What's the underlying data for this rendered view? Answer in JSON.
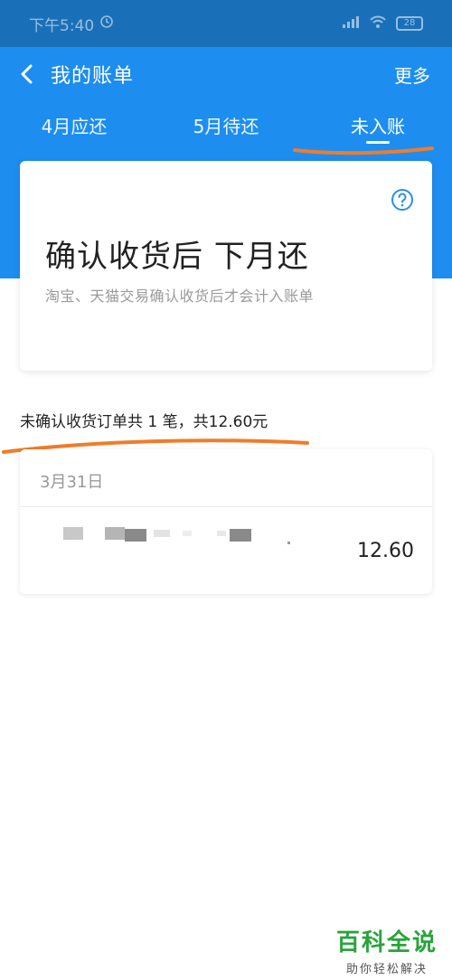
{
  "status_bar": {
    "time": "下午5:40",
    "battery": "28"
  },
  "nav": {
    "title": "我的账单",
    "more": "更多"
  },
  "tabs": [
    {
      "label": "4月应还"
    },
    {
      "label": "5月待还"
    },
    {
      "label": "未入账"
    }
  ],
  "info_card": {
    "title": "确认收货后 下月还",
    "subtitle": "淘宝、天猫交易确认收货后才会计入账单"
  },
  "summary": "未确认收货订单共 1 笔，共12.60元",
  "orders": [
    {
      "date": "3月31日",
      "amount": "12.60"
    }
  ],
  "watermark": {
    "title": "百科全说",
    "subtitle": "助你轻松解决"
  },
  "colors": {
    "header_blue": "#1e8df0",
    "status_blue": "#1a70b8",
    "accent_orange": "#f07c2a",
    "watermark_green": "#2aa33c"
  },
  "icons": [
    "clock-icon",
    "signal-icon",
    "wifi-icon",
    "battery-icon",
    "back-arrow-icon",
    "help-question-icon"
  ]
}
